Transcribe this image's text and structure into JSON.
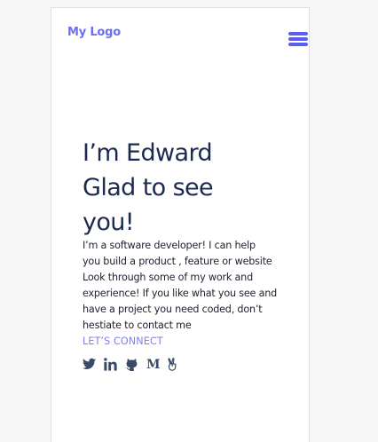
{
  "header": {
    "logo_text": "My Logo",
    "menu_icon": "hamburger-menu-icon"
  },
  "hero": {
    "title_lines": [
      "I’m Edward",
      "Glad to see",
      "you!"
    ],
    "intro_lines": [
      "I’m a software developer! I can help",
      "you build a product , feature or website",
      "Look through some of my work and",
      "experience! If you like what you see and",
      "have a project you need coded, don’t",
      "hestiate to contact me"
    ],
    "cta_label": "LET’S CONNECT"
  },
  "socials": [
    {
      "icon": "twitter-icon"
    },
    {
      "icon": "linkedin-icon"
    },
    {
      "icon": "github-icon"
    },
    {
      "icon": "medium-icon",
      "glyph": "M"
    },
    {
      "icon": "peace-hand-icon"
    }
  ],
  "colors": {
    "page_background": "#f6f6f6",
    "card_background": "#ffffff",
    "brand": "#6c6ff0",
    "menu": "#5a5ff2",
    "heading": "#1b2a4e",
    "body_text": "#222233",
    "link": "#7d7ff2",
    "icon": "#394a66"
  }
}
